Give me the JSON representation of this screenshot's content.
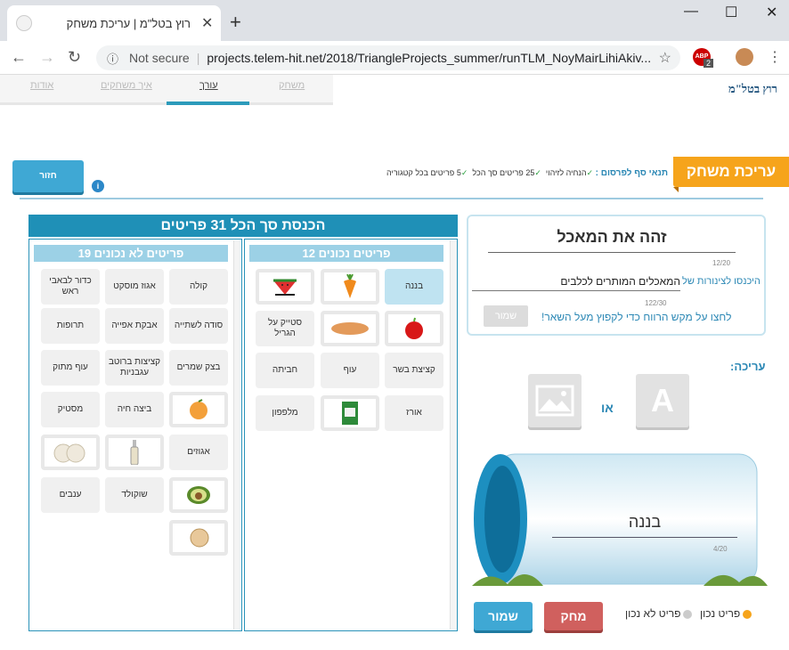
{
  "browser": {
    "tab_title": "רוץ בטל\"מ | עריכת משחק",
    "not_secure": "Not secure",
    "url": "projects.telem-hit.net/2018/TriangleProjects_summer/runTLM_NoyMairLihiAkiv...",
    "ext_badge": "2",
    "ext_label": "ABP"
  },
  "sitenav": {
    "links": [
      "משחק",
      "עורך",
      "איך משחקים",
      "אודות"
    ],
    "active": "עורך",
    "logo": "רוץ בטל\"מ"
  },
  "header": {
    "ribbon": "עריכת משחק",
    "conditions_label": "תנאי סף לפרסום :",
    "conditions": [
      "הנחיה לזיהוי",
      "25 פריטים סך הכל",
      "5 פריטים בכל קטגוריה"
    ],
    "back_label": "חזור",
    "info": "i"
  },
  "lists": {
    "total_title": "הכנסת סך הכל 31 פריטים",
    "correct": {
      "title": "12 פריטים נכונים",
      "items": [
        "בננה",
        "",
        "",
        "",
        "",
        "סטייק על הגריל",
        "קציצת בשר",
        "עוף",
        "חביתה",
        "אורז",
        "",
        "מלפפון"
      ]
    },
    "incorrect": {
      "title": "19 פריטים לא נכונים",
      "items": [
        "קולה",
        "אגוז מוסקט",
        "כדור לבאבי ראש",
        "סודה לשתייה",
        "אבקת אפייה",
        "תרופות",
        "בצק שמרים",
        "קציצות ברוטב עגבניות",
        "עוף מתוק",
        "",
        "ביצה חיה",
        "מסטיק",
        "אגוזים",
        "",
        "",
        "",
        "שוקולד",
        "ענבים",
        ""
      ]
    }
  },
  "editor": {
    "question_title": "זהה את המאכל",
    "title_count": "12/20",
    "sub_label": "היכנסו לצינורות של",
    "sub_value": "המאכלים המותרים לכלבים",
    "sub_count": "122/30",
    "hint": "לחצו על מקש הרווח כדי לקפוץ מעל השאר!",
    "save_small": "שמור",
    "edit_label": "עריכה:",
    "text_option": "A",
    "or": "או",
    "pipe_text": "בננה",
    "pipe_count": "4/20",
    "legend_correct": "פריט נכון",
    "legend_incorrect": "פריט לא נכון",
    "delete_label": "מחק",
    "save_label": "שמור"
  },
  "colors": {
    "accent": "#2c9bbb",
    "orange": "#f6a41b",
    "delete": "#d0605e"
  }
}
